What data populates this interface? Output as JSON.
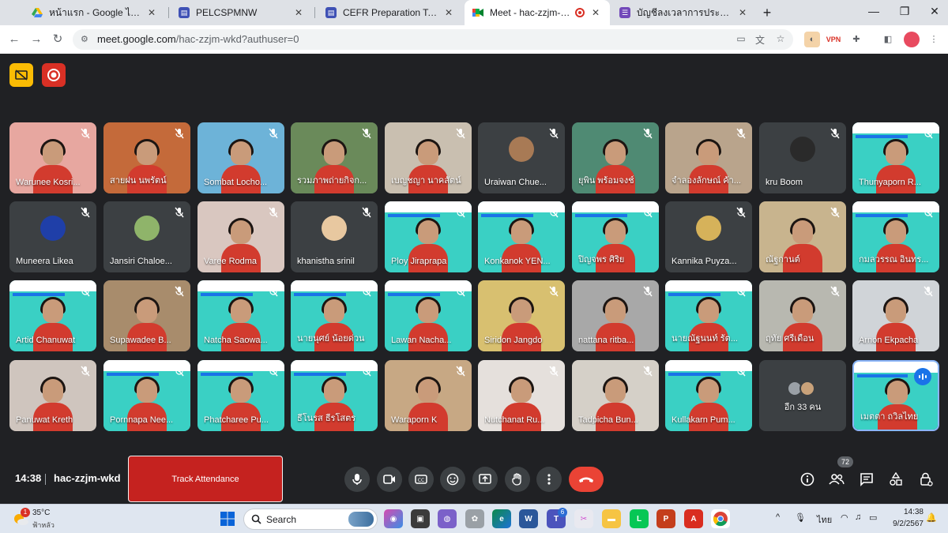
{
  "browser": {
    "tabs": [
      {
        "title": "หน้าแรก - Google ไดรฟ์",
        "icon": "google-drive-icon"
      },
      {
        "title": "PELCSPMNW",
        "icon": "google-sites-icon"
      },
      {
        "title": "CEFR Preparation Test",
        "icon": "google-sites-icon"
      },
      {
        "title": "Meet - hac-zzjm-wkd",
        "icon": "google-meet-icon",
        "active": true
      },
      {
        "title": "บัญชีลงเวลาการประชุมสอบ CEFR ปี",
        "icon": "google-forms-icon"
      }
    ],
    "url_host": "meet.google.com",
    "url_path": "/hac-zzjm-wkd?authuser=0"
  },
  "participants": [
    {
      "name": "Warunee Kosri...",
      "kind": "video",
      "bg": "#e7a7a0"
    },
    {
      "name": "สายฝน นพรัตน์",
      "kind": "video",
      "bg": "#c46a3a"
    },
    {
      "name": "Sombat Locho...",
      "kind": "video",
      "bg": "#6db3d8"
    },
    {
      "name": "รวมภาพถ่ายกิจก...",
      "kind": "video",
      "bg": "#6a8a5a"
    },
    {
      "name": "เบญชญา นาคสัตน์",
      "kind": "video",
      "bg": "#c9bfb0"
    },
    {
      "name": "Uraiwan Chue...",
      "kind": "avatar",
      "avatar": "#a87a55"
    },
    {
      "name": "ยุพิน พร้อมจงช์",
      "kind": "video",
      "bg": "#4f8a73"
    },
    {
      "name": "จำลองลักษณ์ ค้า...",
      "kind": "video",
      "bg": "#b9a48c"
    },
    {
      "name": "kru Boom",
      "kind": "avatar",
      "avatar": "#2a2a2a"
    },
    {
      "name": "Thunyaporn R...",
      "kind": "slide"
    },
    {
      "name": "Muneera Likea",
      "kind": "avatar",
      "avatar": "#1f3fa8"
    },
    {
      "name": "Jansiri Chaloe...",
      "kind": "avatar",
      "avatar": "#8fb46a"
    },
    {
      "name": "Varee Rodma",
      "kind": "video",
      "bg": "#d9c7c0"
    },
    {
      "name": "khanistha srinil",
      "kind": "avatar",
      "avatar": "#e8c8a0"
    },
    {
      "name": "Ploy Jiraprapa",
      "kind": "slide"
    },
    {
      "name": "Konkanok YEN...",
      "kind": "slide"
    },
    {
      "name": "ปิญจพร ศิริย",
      "kind": "slide"
    },
    {
      "name": "Kannika Puyza...",
      "kind": "avatar",
      "avatar": "#d6b25a"
    },
    {
      "name": "ณัฐกานต์",
      "kind": "video",
      "bg": "#c8b48e"
    },
    {
      "name": "กมลวรรณ อินทร...",
      "kind": "slide"
    },
    {
      "name": "Artid Chanuwat",
      "kind": "slide"
    },
    {
      "name": "Supawadee B...",
      "kind": "video",
      "bg": "#a88c6c"
    },
    {
      "name": "Natcha Saowa...",
      "kind": "slide"
    },
    {
      "name": "นายนุศย์ น้อยด่วน",
      "kind": "slide"
    },
    {
      "name": "Lawan Nacha...",
      "kind": "slide"
    },
    {
      "name": "Siridon Jangdo",
      "kind": "video",
      "bg": "#d8c070"
    },
    {
      "name": "nattana ritba...",
      "kind": "video",
      "bg": "#a8a8a8"
    },
    {
      "name": "นายณัฐนนท์ รัต...",
      "kind": "slide"
    },
    {
      "name": "ฤทัย ศรีเดือน",
      "kind": "video",
      "bg": "#b8b8b0"
    },
    {
      "name": "Arnon Ekpacha",
      "kind": "video",
      "bg": "#d0d4d8"
    },
    {
      "name": "Panuwat Kreth",
      "kind": "video",
      "bg": "#cfc5be"
    },
    {
      "name": "Pornnapa Nee...",
      "kind": "slide"
    },
    {
      "name": "Phatcharee Pu...",
      "kind": "slide"
    },
    {
      "name": "ธีโนรส ธีรโสตร",
      "kind": "slide"
    },
    {
      "name": "Waraporn K",
      "kind": "video",
      "bg": "#c7a884"
    },
    {
      "name": "Nutchanat Ru...",
      "kind": "video",
      "bg": "#e5e0dc"
    },
    {
      "name": "Tadpicha Bun...",
      "kind": "video",
      "bg": "#d5d0c8"
    },
    {
      "name": "Kullakarn Pum...",
      "kind": "slide"
    },
    {
      "name": "อีก 33 คน",
      "kind": "more"
    },
    {
      "name": "เมตตา ถวิลไทย",
      "kind": "slide",
      "speaking": true
    }
  ],
  "call": {
    "time": "14:38",
    "code": "hac-zzjm-wkd",
    "track_label": "Track Attendance",
    "people_count": "72"
  },
  "taskbar": {
    "temp": "35°C",
    "condition": "ฟ้าหลัว",
    "weather_badge": "1",
    "search_label": "Search",
    "lang": "ไทย",
    "time": "14:38",
    "date": "9/2/2567",
    "teams_badge": "6"
  },
  "colors": {
    "meet_bg": "#202124",
    "tile_bg": "#3c4043",
    "end_call": "#ea4335",
    "track_button": "#c5221f",
    "speaking_border": "#8ab4f8",
    "slide_bg": "#3ad0c4"
  }
}
